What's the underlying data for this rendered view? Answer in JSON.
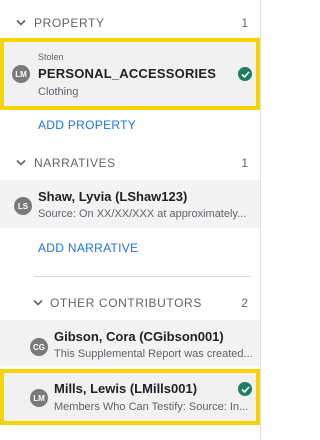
{
  "property": {
    "title": "PROPERTY",
    "count": "1",
    "item": {
      "avatar": "LM",
      "tag": "Stolen",
      "name": "PERSONAL_ACCESSORIES",
      "category": "Clothing"
    },
    "add_label": "ADD PROPERTY"
  },
  "narratives": {
    "title": "NARRATIVES",
    "count": "1",
    "item": {
      "avatar": "LS",
      "author": "Shaw, Lyvia (LShaw123)",
      "snippet": "Source: On XX/XX/XXX at approximately..."
    },
    "add_label": "ADD NARRATIVE"
  },
  "other_contributors": {
    "title": "OTHER CONTRIBUTORS",
    "count": "2",
    "items": [
      {
        "avatar": "CG",
        "author": "Gibson, Cora (CGibson001)",
        "snippet": "This Supplemental Report was created..."
      },
      {
        "avatar": "LM",
        "author": "Mills, Lewis (LMills001)",
        "snippet": "Members Who Can Testify: Source: In..."
      }
    ]
  },
  "colors": {
    "highlight": "#f7d400",
    "status_check": "#1e7d63",
    "link": "#1a73e8"
  },
  "icons": [
    "chevron-down-icon",
    "check-circle-icon"
  ]
}
